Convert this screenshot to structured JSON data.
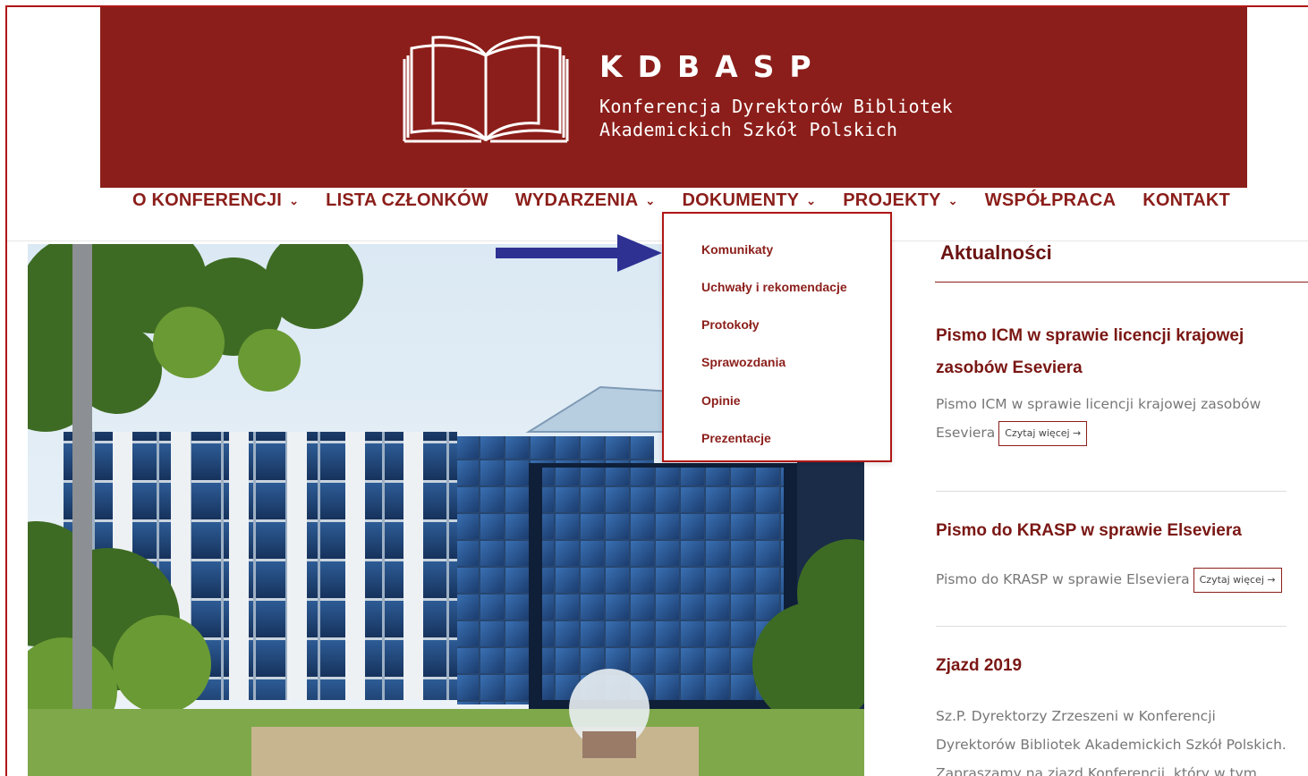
{
  "header": {
    "brand_name": "KDBASP",
    "brand_sub_line1": "Konferencja Dyrektorów Bibliotek",
    "brand_sub_line2": "Akademickich Szkół Polskich",
    "logo_icon": "open-book-icon",
    "banner_color": "#8b1e1a"
  },
  "nav": {
    "items": [
      {
        "label": "O KONFERENCJI",
        "has_dropdown": true
      },
      {
        "label": "LISTA CZŁONKÓW",
        "has_dropdown": false
      },
      {
        "label": "WYDARZENIA",
        "has_dropdown": true
      },
      {
        "label": "DOKUMENTY",
        "has_dropdown": true
      },
      {
        "label": "PROJEKTY",
        "has_dropdown": true
      },
      {
        "label": "WSPÓŁPRACA",
        "has_dropdown": false
      },
      {
        "label": "KONTAKT",
        "has_dropdown": false
      }
    ],
    "chevron": "⌄"
  },
  "dropdown": {
    "parent": "DOKUMENTY",
    "items": [
      "Komunikaty",
      "Uchwały i rekomendacje",
      "Protokoły",
      "Sprawozdania",
      "Opinie",
      "Prezentacje"
    ]
  },
  "hero": {
    "icon": "building-photo"
  },
  "sidebar": {
    "title": "Aktualności",
    "posts": [
      {
        "title_line1": "Pismo ICM w sprawie licencji krajowej",
        "title_line2": "zasobów Eseviera",
        "text_line1": "Pismo ICM w sprawie licencji krajowej zasobów",
        "text_line2": "Eseviera",
        "more": "Czytaj więcej →"
      },
      {
        "title_line1": "Pismo do KRASP w sprawie Elseviera",
        "text_line1": "Pismo do KRASP w sprawie Elseviera",
        "more": "Czytaj więcej →"
      },
      {
        "title_line1": "Zjazd 2019",
        "text_line1": "Sz.P. Dyrektorzy Zrzeszeni w Konferencji",
        "text_line2": "Dyrektorów Bibliotek Akademickich Szkół Polskich.",
        "text_line3": "Zapraszamy na zjazd Konferencji, który w tym"
      }
    ]
  },
  "colors": {
    "accent": "#8b1e1a",
    "arrow": "#2e3192",
    "border": "#b01616"
  }
}
